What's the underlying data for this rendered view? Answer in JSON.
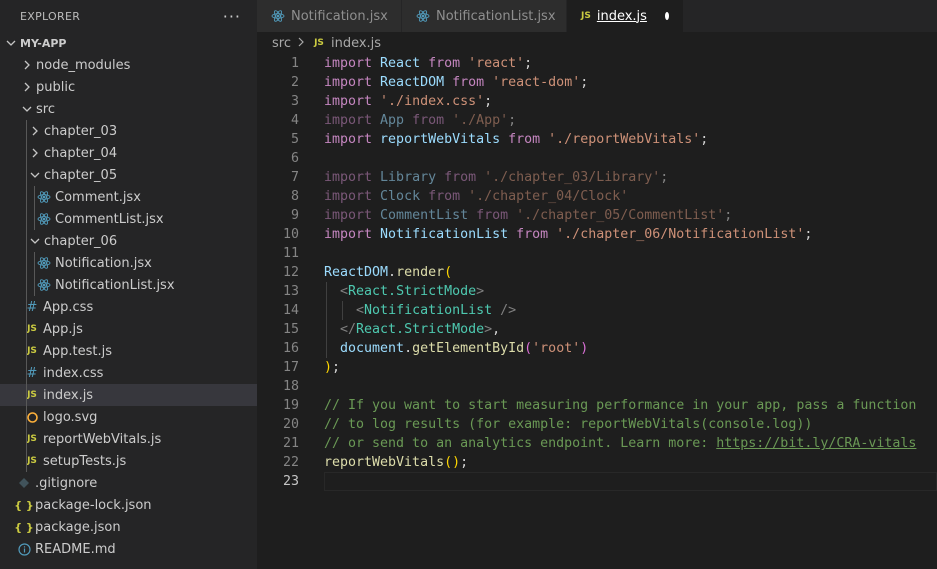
{
  "explorer": {
    "title": "EXPLORER",
    "more": "···",
    "project": "MY-APP",
    "items": [
      {
        "label": "node_modules",
        "type": "folder",
        "depth": 1,
        "open": false
      },
      {
        "label": "public",
        "type": "folder",
        "depth": 1,
        "open": false
      },
      {
        "label": "src",
        "type": "folder",
        "depth": 1,
        "open": true
      },
      {
        "label": "chapter_03",
        "type": "folder",
        "depth": 2,
        "open": false
      },
      {
        "label": "chapter_04",
        "type": "folder",
        "depth": 2,
        "open": false
      },
      {
        "label": "chapter_05",
        "type": "folder",
        "depth": 2,
        "open": true
      },
      {
        "label": "Comment.jsx",
        "type": "react",
        "depth": 3
      },
      {
        "label": "CommentList.jsx",
        "type": "react",
        "depth": 3
      },
      {
        "label": "chapter_06",
        "type": "folder",
        "depth": 2,
        "open": true
      },
      {
        "label": "Notification.jsx",
        "type": "react",
        "depth": 3
      },
      {
        "label": "NotificationList.jsx",
        "type": "react",
        "depth": 3
      },
      {
        "label": "App.css",
        "type": "css",
        "depth": 2
      },
      {
        "label": "App.js",
        "type": "js",
        "depth": 2
      },
      {
        "label": "App.test.js",
        "type": "js",
        "depth": 2
      },
      {
        "label": "index.css",
        "type": "css",
        "depth": 2
      },
      {
        "label": "index.js",
        "type": "js",
        "depth": 2,
        "selected": true
      },
      {
        "label": "logo.svg",
        "type": "svg",
        "depth": 2
      },
      {
        "label": "reportWebVitals.js",
        "type": "js",
        "depth": 2
      },
      {
        "label": "setupTests.js",
        "type": "js",
        "depth": 2
      },
      {
        "label": ".gitignore",
        "type": "git",
        "depth": 1
      },
      {
        "label": "package-lock.json",
        "type": "json",
        "depth": 1
      },
      {
        "label": "package.json",
        "type": "json",
        "depth": 1
      },
      {
        "label": "README.md",
        "type": "info",
        "depth": 1
      }
    ]
  },
  "tabs": [
    {
      "label": "Notification.jsx",
      "icon": "react",
      "active": false
    },
    {
      "label": "NotificationList.jsx",
      "icon": "react",
      "active": false
    },
    {
      "label": "index.js",
      "icon": "js",
      "active": true,
      "modified": true
    }
  ],
  "icons": {
    "js": "JS",
    "css": "#",
    "json": "{ }"
  },
  "breadcrumb": {
    "folder": "src",
    "file": "index.js"
  },
  "editor": {
    "current_line": 23,
    "lines": [
      [
        [
          "kw",
          "import "
        ],
        [
          "id",
          "React "
        ],
        [
          "kw",
          "from "
        ],
        [
          "str",
          "'react'"
        ],
        [
          "pl",
          ";"
        ]
      ],
      [
        [
          "kw",
          "import "
        ],
        [
          "id",
          "ReactDOM "
        ],
        [
          "kw",
          "from "
        ],
        [
          "str",
          "'react-dom'"
        ],
        [
          "pl",
          ";"
        ]
      ],
      [
        [
          "kw",
          "import "
        ],
        [
          "str",
          "'./index.css'"
        ],
        [
          "pl",
          ";"
        ]
      ],
      [
        [
          "kw dim",
          "import "
        ],
        [
          "id dim",
          "App "
        ],
        [
          "kw dim",
          "from "
        ],
        [
          "str dim",
          "'./App'"
        ],
        [
          "pl dim",
          ";"
        ]
      ],
      [
        [
          "kw",
          "import "
        ],
        [
          "id",
          "reportWebVitals "
        ],
        [
          "kw",
          "from "
        ],
        [
          "str",
          "'./reportWebVitals'"
        ],
        [
          "pl",
          ";"
        ]
      ],
      [],
      [
        [
          "kw dim",
          "import "
        ],
        [
          "id dim",
          "Library "
        ],
        [
          "kw dim",
          "from "
        ],
        [
          "str dim",
          "'./chapter_03/Library'"
        ],
        [
          "pl dim",
          ";"
        ]
      ],
      [
        [
          "kw dim",
          "import "
        ],
        [
          "id dim",
          "Clock "
        ],
        [
          "kw dim",
          "from "
        ],
        [
          "str dim",
          "'./chapter_04/Clock'"
        ]
      ],
      [
        [
          "kw dim",
          "import "
        ],
        [
          "id dim",
          "CommentList "
        ],
        [
          "kw dim",
          "from "
        ],
        [
          "str dim",
          "'./chapter_05/CommentList'"
        ],
        [
          "pl dim",
          ";"
        ]
      ],
      [
        [
          "kw",
          "import "
        ],
        [
          "id",
          "NotificationList "
        ],
        [
          "kw",
          "from "
        ],
        [
          "str",
          "'./chapter_06/NotificationList'"
        ],
        [
          "pl",
          ";"
        ]
      ],
      [],
      [
        [
          "id",
          "ReactDOM"
        ],
        [
          "pl",
          "."
        ],
        [
          "fn",
          "render"
        ],
        [
          "paren",
          "("
        ]
      ],
      [
        [
          "pl",
          "  "
        ],
        [
          "br",
          "<"
        ],
        [
          "tag",
          "React.StrictMode"
        ],
        [
          "br",
          ">"
        ]
      ],
      [
        [
          "pl",
          "    "
        ],
        [
          "br",
          "<"
        ],
        [
          "tag",
          "NotificationList "
        ],
        [
          "br",
          "/>"
        ]
      ],
      [
        [
          "pl",
          "  "
        ],
        [
          "br",
          "</"
        ],
        [
          "tag",
          "React.StrictMode"
        ],
        [
          "br",
          ">"
        ],
        [
          "pl",
          ","
        ]
      ],
      [
        [
          "pl",
          "  "
        ],
        [
          "id",
          "document"
        ],
        [
          "pl",
          "."
        ],
        [
          "fn",
          "getElementById"
        ],
        [
          "paren2",
          "("
        ],
        [
          "str",
          "'root'"
        ],
        [
          "paren2",
          ")"
        ]
      ],
      [
        [
          "paren",
          ")"
        ],
        [
          "pl",
          ";"
        ]
      ],
      [],
      [
        [
          "cm",
          "// If you want to start measuring performance in your app, pass a function"
        ]
      ],
      [
        [
          "cm",
          "// to log results (for example: reportWebVitals(console.log))"
        ]
      ],
      [
        [
          "cm",
          "// or send to an analytics endpoint. Learn more: "
        ],
        [
          "cm link",
          "https://bit.ly/CRA-vitals"
        ]
      ],
      [
        [
          "fn",
          "reportWebVitals"
        ],
        [
          "paren",
          "()"
        ],
        [
          "pl",
          ";"
        ]
      ],
      []
    ]
  }
}
